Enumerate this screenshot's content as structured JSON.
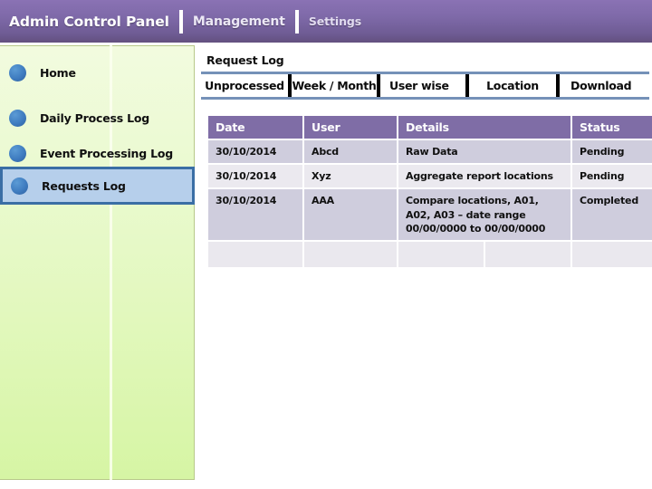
{
  "header": {
    "items": [
      {
        "label": "Admin Control Panel"
      },
      {
        "label": "Management"
      },
      {
        "label": "Settings"
      }
    ]
  },
  "sidebar": {
    "items": [
      {
        "label": "Home",
        "icon": "bullet-circle-icon",
        "selected": false
      },
      {
        "label": "Daily Process Log",
        "icon": "bullet-circle-icon",
        "selected": false
      },
      {
        "label": "Event Processing Log",
        "icon": "bullet-circle-icon",
        "selected": false
      },
      {
        "label": "Requests Log",
        "icon": "bullet-circle-icon",
        "selected": true
      }
    ]
  },
  "main": {
    "panel_title": "Request Log",
    "tabs": [
      {
        "label": "Unprocessed"
      },
      {
        "label": "Week / Month"
      },
      {
        "label": "User wise"
      },
      {
        "label": "Location"
      },
      {
        "label": "Download"
      }
    ],
    "table": {
      "columns": [
        "Date",
        "User",
        "Details",
        "Status"
      ],
      "rows": [
        {
          "date": "30/10/2014",
          "user": "Abcd",
          "details": "Raw Data",
          "status": "Pending"
        },
        {
          "date": "30/10/2014",
          "user": "Xyz",
          "details": "Aggregate report locations",
          "status": "Pending"
        },
        {
          "date": "30/10/2014",
          "user": "AAA",
          "details": "Compare locations, A01, A02, A03 – date range 00/00/0000 to 00/00/0000",
          "status": "Completed"
        }
      ],
      "empty_row": {
        "date": "",
        "user": "",
        "details_a": "",
        "details_b": "",
        "status": ""
      }
    }
  },
  "colors": {
    "header_purple_top": "#8a72b4",
    "header_purple_bottom": "#63507f",
    "sidebar_green_top": "#f2fbdf",
    "sidebar_green_bottom": "#d6f5a4",
    "selected_fill": "#b6cfeb",
    "selected_border": "#3a6ea5",
    "table_header": "#7f6da6",
    "row_dark": "#cfcddd",
    "row_light": "#ebe9ef",
    "tabbar_border": "#7591b8",
    "bullet_blue": "#3f7cc0"
  }
}
